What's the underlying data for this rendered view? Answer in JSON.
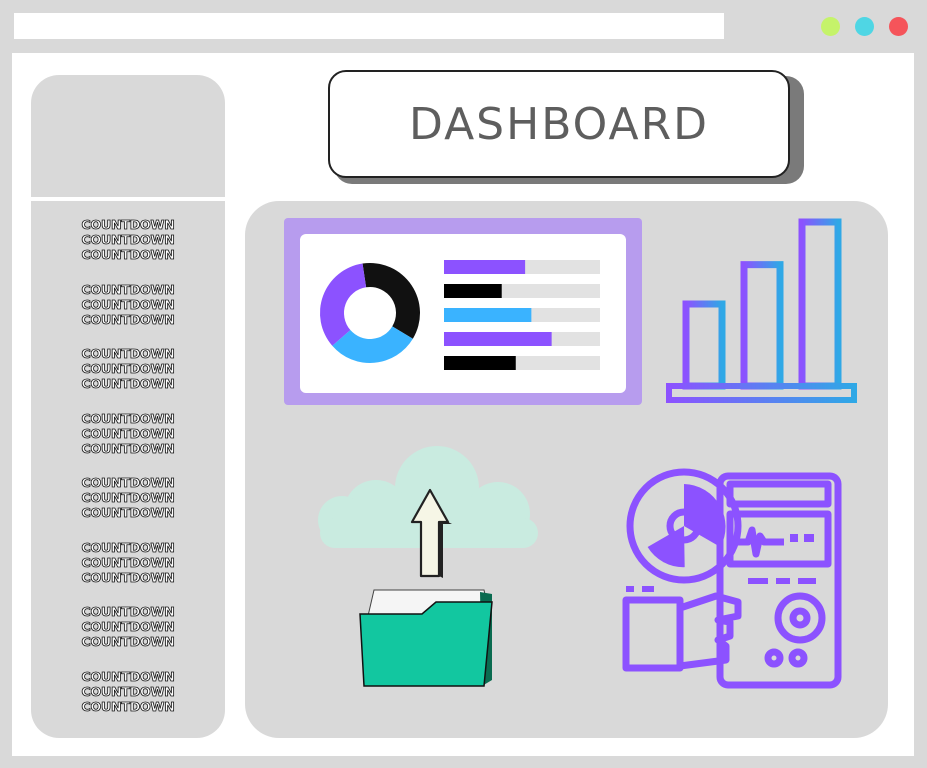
{
  "window": {
    "controls": [
      {
        "name": "minimize",
        "color": "#c5f36a"
      },
      {
        "name": "maximize",
        "color": "#4fd6e4"
      },
      {
        "name": "close",
        "color": "#f5545a"
      }
    ]
  },
  "header": {
    "title": "DASHBOARD"
  },
  "sidebar": {
    "items": [
      {
        "lines": [
          "COUNTDOWN",
          "COUNTDOWN",
          "COUNTDOWN"
        ]
      },
      {
        "lines": [
          "COUNTDOWN",
          "COUNTDOWN",
          "COUNTDOWN"
        ]
      },
      {
        "lines": [
          "COUNTDOWN",
          "COUNTDOWN",
          "COUNTDOWN"
        ]
      },
      {
        "lines": [
          "COUNTDOWN",
          "COUNTDOWN",
          "COUNTDOWN"
        ]
      },
      {
        "lines": [
          "COUNTDOWN",
          "COUNTDOWN",
          "COUNTDOWN"
        ]
      },
      {
        "lines": [
          "COUNTDOWN",
          "COUNTDOWN",
          "COUNTDOWN"
        ]
      },
      {
        "lines": [
          "COUNTDOWN",
          "COUNTDOWN",
          "COUNTDOWN"
        ]
      },
      {
        "lines": [
          "COUNTDOWN",
          "COUNTDOWN",
          "COUNTDOWN"
        ]
      }
    ]
  },
  "widgets": {
    "donut": {
      "segments": [
        {
          "value": 0.36,
          "color": "#111111"
        },
        {
          "value": 0.3,
          "color": "#3ab3ff"
        },
        {
          "value": 0.34,
          "color": "#8c52ff"
        }
      ]
    },
    "bars": [
      {
        "fill": 0.52,
        "color": "#8c52ff"
      },
      {
        "fill": 0.37,
        "color": "#000000"
      },
      {
        "fill": 0.56,
        "color": "#3ab3ff"
      },
      {
        "fill": 0.69,
        "color": "#8c52ff"
      },
      {
        "fill": 0.46,
        "color": "#000000"
      }
    ],
    "bar_chart_icon": {
      "name": "bar-chart-icon",
      "levels": [
        0.5,
        0.74,
        1.0
      ]
    },
    "upload_icon": {
      "name": "cloud-upload-folder-icon"
    },
    "monitor_icon": {
      "name": "radiation-monitor-icon"
    },
    "colors": {
      "accent_purple": "#8c52ff",
      "accent_blue": "#3ab3ff",
      "card_frame": "#b79cee",
      "folder_green": "#12c7a0",
      "cloud": "#c9ebe0"
    }
  }
}
